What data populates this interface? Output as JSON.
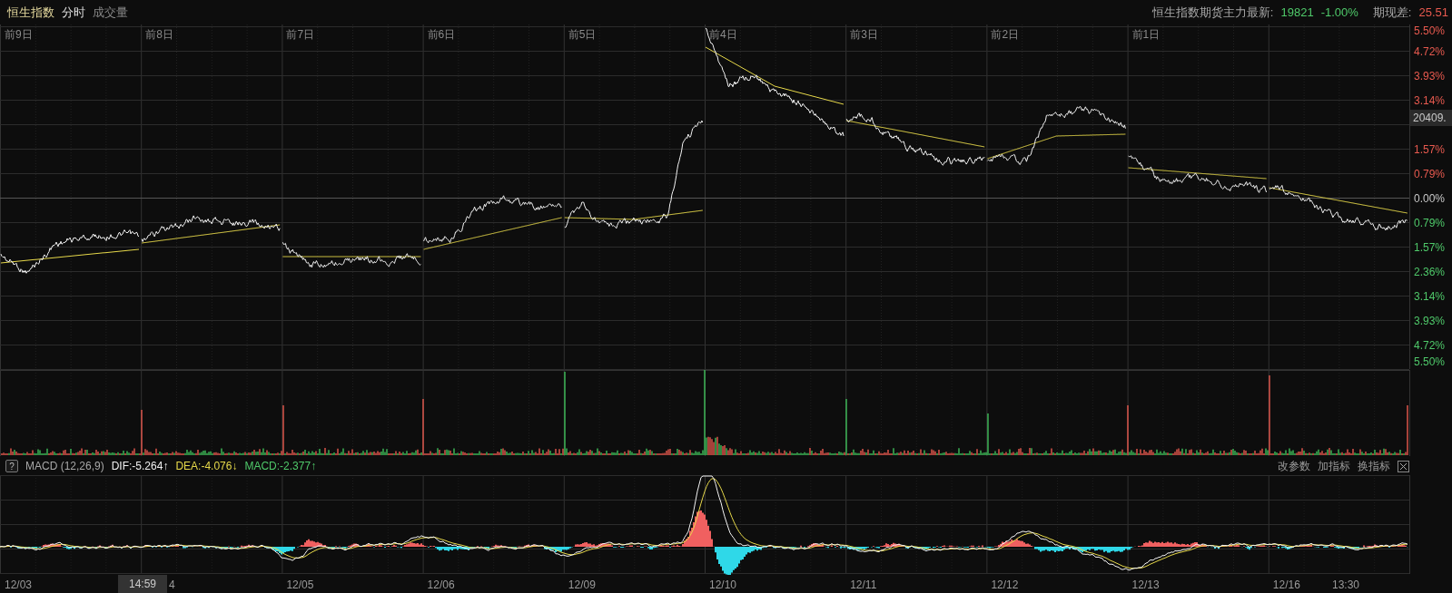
{
  "header": {
    "title": "恒生指数",
    "tabs": [
      {
        "label": "分时",
        "selected": true
      },
      {
        "label": "成交量",
        "selected": false
      }
    ]
  },
  "futures": {
    "label": "恒生指数期货主力最新:",
    "price": "19821",
    "change": "-1.00%",
    "spread_label": "期现差:",
    "spread": "25.51"
  },
  "main_chart": {
    "day_labels": [
      "前9日",
      "前8日",
      "前7日",
      "前6日",
      "前5日",
      "前4日",
      "前3日",
      "前2日",
      "前1日"
    ],
    "y_labels": [
      {
        "text": "5.50%",
        "kind": "up"
      },
      {
        "text": "4.72%",
        "kind": "up"
      },
      {
        "text": "3.93%",
        "kind": "up"
      },
      {
        "text": "3.14%",
        "kind": "up"
      },
      {
        "text": "1.57%",
        "kind": "up"
      },
      {
        "text": "0.79%",
        "kind": "up"
      },
      {
        "text": "0.00%",
        "kind": "flat"
      },
      {
        "text": "0.79%",
        "kind": "down"
      },
      {
        "text": "1.57%",
        "kind": "down"
      },
      {
        "text": "2.36%",
        "kind": "down"
      },
      {
        "text": "3.14%",
        "kind": "down"
      },
      {
        "text": "3.93%",
        "kind": "down"
      },
      {
        "text": "4.72%",
        "kind": "down"
      },
      {
        "text": "5.50%",
        "kind": "down"
      }
    ],
    "price_tag": "20409."
  },
  "macd": {
    "help": "?",
    "title": "MACD (12,26,9)",
    "values": [
      {
        "text": "DIF:-5.264↑",
        "kind": "dif"
      },
      {
        "text": "DEA:-4.076↓",
        "kind": "dea"
      },
      {
        "text": "MACD:-2.377↑",
        "kind": "macd"
      }
    ],
    "buttons": [
      "改参数",
      "加指标",
      "换指标"
    ]
  },
  "x_axis": {
    "cursor_time": "14:59",
    "labels": [
      "12/03",
      "4",
      "12/05",
      "12/06",
      "12/09",
      "12/10",
      "12/11",
      "12/12",
      "12/13",
      "12/16",
      "13:30"
    ]
  }
}
